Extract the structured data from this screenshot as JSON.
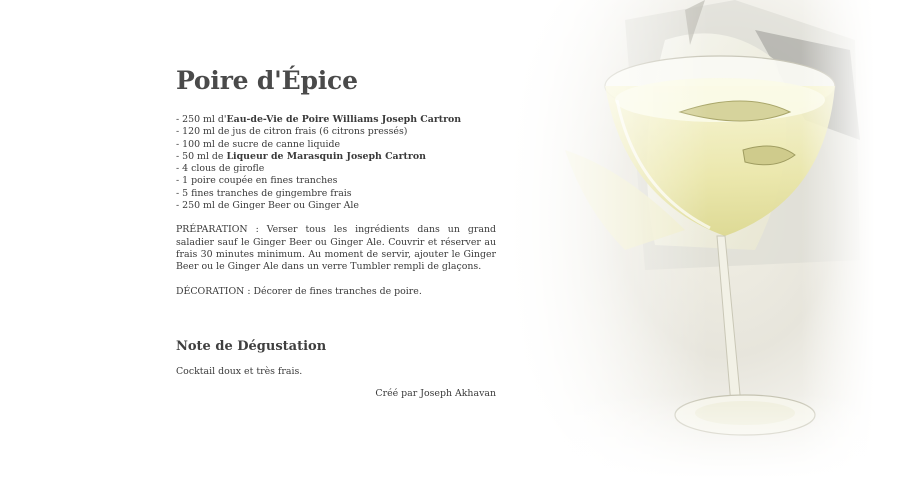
{
  "recipe": {
    "title": "Poire d'Épice",
    "ingredients": [
      {
        "pre": "- 250 ml d'",
        "bold": "Eau-de-Vie de Poire Williams Joseph Cartron",
        "post": ""
      },
      {
        "pre": "- 120 ml de jus de citron frais (6 citrons pressés)",
        "bold": "",
        "post": ""
      },
      {
        "pre": "- 100 ml de sucre de canne liquide",
        "bold": "",
        "post": ""
      },
      {
        "pre": "- 50 ml de ",
        "bold": "Liqueur de Marasquin Joseph Cartron",
        "post": ""
      },
      {
        "pre": "- 4 clous de girofle",
        "bold": "",
        "post": ""
      },
      {
        "pre": "- 1 poire coupée en fines tranches",
        "bold": "",
        "post": ""
      },
      {
        "pre": "- 5 fines tranches de gingembre frais",
        "bold": "",
        "post": ""
      },
      {
        "pre": "- 250 ml de Ginger Beer ou Ginger Ale",
        "bold": "",
        "post": ""
      }
    ],
    "preparation": "PRÉPARATION : Verser tous les ingrédients dans un grand saladier sauf le Ginger Beer ou Ginger Ale. Couvrir et réserver au frais 30 minutes minimum. Au moment de servir, ajouter le Ginger Beer ou le Ginger Ale dans un verre Tumbler rempli de glaçons.",
    "decoration": "DÉCORATION : Décorer de fines tranches de poire."
  },
  "tasting": {
    "title": "Note de Dégustation",
    "text": "Cocktail doux et très frais."
  },
  "credit": "Créé par Joseph Akhavan",
  "colors": {
    "text": "#3a3a3a",
    "heading": "#4a4a4a",
    "background": "#ffffff"
  },
  "icons": {
    "photo": "cocktail-glass-photo"
  }
}
